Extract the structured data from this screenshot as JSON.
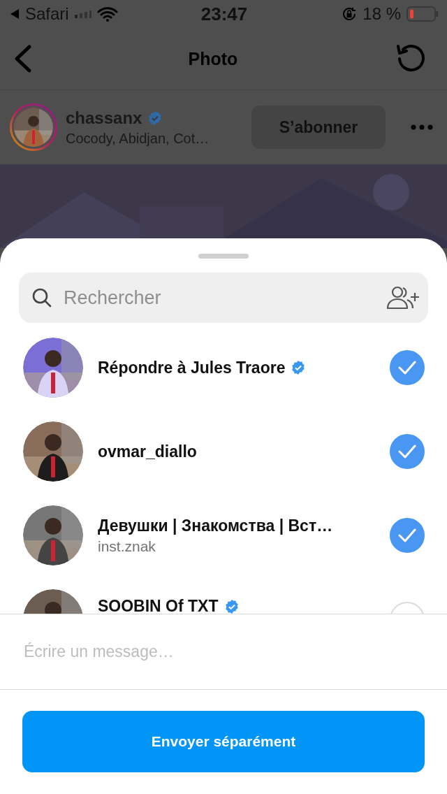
{
  "status_bar": {
    "back_app": "Safari",
    "time": "23:47",
    "battery": "18 %"
  },
  "header": {
    "title": "Photo"
  },
  "post": {
    "username": "chassanx",
    "verified": true,
    "location": "Cocody, Abidjan, Cot…",
    "follow_button": "S’abonner"
  },
  "share_sheet": {
    "search": {
      "placeholder": "Rechercher"
    },
    "recipients": [
      {
        "name": "Répondre à Jules Traore",
        "verified": true,
        "selected": true
      },
      {
        "name": "ovmar_diallo",
        "verified": false,
        "selected": true
      },
      {
        "name": "Девушки | Знакомства | Вст…",
        "subtitle": "inst.znak",
        "verified": false,
        "selected": true
      },
      {
        "name": "SOOBIN Of TXT",
        "verified": true,
        "selected": false
      }
    ],
    "message": {
      "placeholder": "Écrire un message…"
    },
    "send_button": "Envoyer séparément"
  }
}
